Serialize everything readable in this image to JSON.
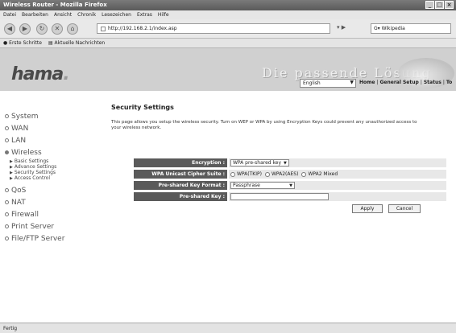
{
  "window": {
    "title": "Wireless Router - Mozilla Firefox",
    "menu": [
      "Datei",
      "Bearbeiten",
      "Ansicht",
      "Chronik",
      "Lesezeichen",
      "Extras",
      "Hilfe"
    ]
  },
  "nav": {
    "url": "http://192.168.2.1/index.asp",
    "search_placeholder": "Wikipedia"
  },
  "bookmarks": [
    "Erste Schritte",
    "Aktuelle Nachrichten"
  ],
  "header": {
    "logo": "hama",
    "tagline": "Die passende Lösung",
    "language": "English",
    "links": [
      "Home",
      "General Setup",
      "Status",
      "To"
    ]
  },
  "sidebar": {
    "items": [
      {
        "label": "System"
      },
      {
        "label": "WAN"
      },
      {
        "label": "LAN"
      },
      {
        "label": "Wireless"
      },
      {
        "label": "QoS"
      },
      {
        "label": "NAT"
      },
      {
        "label": "Firewall"
      },
      {
        "label": "Print Server"
      },
      {
        "label": "File/FTP Server"
      }
    ],
    "wireless_sub": [
      "Basic Settings",
      "Advance Settings",
      "Security Settings",
      "Access Control"
    ]
  },
  "main": {
    "title": "Security Settings",
    "description": "This page allows you setup the wireless security. Turn on WEP or WPA by using Encryption Keys could prevent any unauthorized access to your wireless network.",
    "encryption_label": "Encryption :",
    "encryption_value": "WPA pre-shared key",
    "cipher_label": "WPA Unicast Cipher Suite :",
    "cipher_options": [
      "WPA(TKIP)",
      "WPA2(AES)",
      "WPA2 Mixed"
    ],
    "key_format_label": "Pre-shared Key Format :",
    "key_format_value": "Passphrase",
    "key_label": "Pre-shared Key :",
    "key_value": "",
    "apply": "Apply",
    "cancel": "Cancel"
  },
  "status": "Fertig"
}
